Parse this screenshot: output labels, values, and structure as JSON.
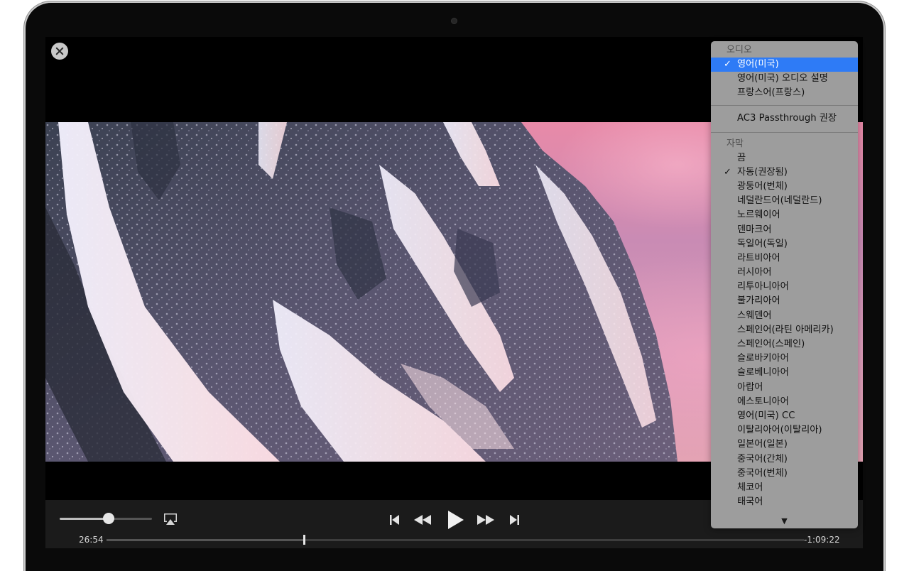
{
  "player": {
    "time_elapsed": "26:54",
    "time_remaining": "-1:09:22",
    "progress": 0.283,
    "volume": 0.53
  },
  "menu": {
    "audio_header": "오디오",
    "audio_items": [
      {
        "label": "영어(미국)",
        "selected": true
      },
      {
        "label": "영어(미국) 오디오 설명",
        "selected": false
      },
      {
        "label": "프랑스어(프랑스)",
        "selected": false
      }
    ],
    "ac3_item": "AC3 Passthrough 권장",
    "subtitle_header": "자막",
    "subtitle_items": [
      {
        "label": "끔",
        "checked": false
      },
      {
        "label": "자동(권장됨)",
        "checked": true
      },
      {
        "label": "광둥어(번체)",
        "checked": false
      },
      {
        "label": "네덜란드어(네덜란드)",
        "checked": false
      },
      {
        "label": "노르웨이어",
        "checked": false
      },
      {
        "label": "덴마크어",
        "checked": false
      },
      {
        "label": "독일어(독일)",
        "checked": false
      },
      {
        "label": "라트비아어",
        "checked": false
      },
      {
        "label": "러시아어",
        "checked": false
      },
      {
        "label": "리투아니아어",
        "checked": false
      },
      {
        "label": "불가리아어",
        "checked": false
      },
      {
        "label": "스웨덴어",
        "checked": false
      },
      {
        "label": "스페인어(라틴 아메리카)",
        "checked": false
      },
      {
        "label": "스페인어(스페인)",
        "checked": false
      },
      {
        "label": "슬로바키아어",
        "checked": false
      },
      {
        "label": "슬로베니아어",
        "checked": false
      },
      {
        "label": "아랍어",
        "checked": false
      },
      {
        "label": "에스토니아어",
        "checked": false
      },
      {
        "label": "영어(미국) CC",
        "checked": false
      },
      {
        "label": "이탈리아어(이탈리아)",
        "checked": false
      },
      {
        "label": "일본어(일본)",
        "checked": false
      },
      {
        "label": "중국어(간체)",
        "checked": false
      },
      {
        "label": "중국어(번체)",
        "checked": false
      },
      {
        "label": "체코어",
        "checked": false
      },
      {
        "label": "태국어",
        "checked": false
      }
    ],
    "check_glyph": "✓",
    "scroll_glyph": "▼"
  },
  "icons": {
    "close": "close-icon",
    "airplay": "airplay-icon",
    "skip_back": "skip-back-icon",
    "rewind": "rewind-icon",
    "play": "play-icon",
    "fast_forward": "fast-forward-icon",
    "skip_forward": "skip-forward-icon",
    "scroll_down": "chevron-down-icon"
  },
  "colors": {
    "selection": "#2e7bf6",
    "menu_background": "#9d9d9d",
    "control_bar": "#1b1b1b"
  }
}
